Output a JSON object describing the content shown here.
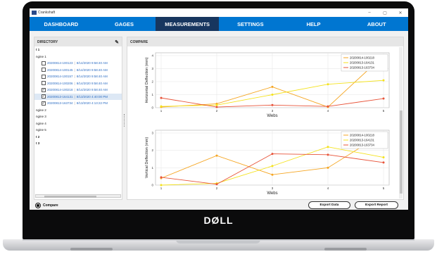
{
  "window": {
    "title": "Crankshaft",
    "min": "–",
    "max": "▢",
    "close": "✕"
  },
  "nav": {
    "tabs": [
      {
        "label": "DASHBOARD",
        "active": false
      },
      {
        "label": "GAGES",
        "active": false
      },
      {
        "label": "MEASUREMENTS",
        "active": true
      },
      {
        "label": "SETTINGS",
        "active": false
      },
      {
        "label": "HELP",
        "active": false
      },
      {
        "label": "ABOUT",
        "active": false
      }
    ],
    "accent": "#0076d1",
    "active_color": "#17365f"
  },
  "directory": {
    "title": "DIRECTORY",
    "edit_icon": "pencil-icon",
    "rows": [
      {
        "type": "group",
        "label": "t 1"
      },
      {
        "type": "group",
        "label": "ngine 1"
      },
      {
        "type": "file",
        "id": "20200814-100123",
        "date": "8/14/2020 9:58:40 AM",
        "checked": false,
        "selected": false
      },
      {
        "type": "file",
        "id": "20200814-100145",
        "date": "8/14/2020 9:58:40 AM",
        "checked": false,
        "selected": false
      },
      {
        "type": "file",
        "id": "20200814-100157",
        "date": "8/14/2020 9:58:40 AM",
        "checked": false,
        "selected": false
      },
      {
        "type": "file",
        "id": "20200814-100206",
        "date": "8/14/2020 9:58:40 AM",
        "checked": false,
        "selected": false
      },
      {
        "type": "file",
        "id": "20200814-100218",
        "date": "8/14/2020 9:58:40 AM",
        "checked": true,
        "selected": false
      },
      {
        "type": "file",
        "id": "20200813-164131",
        "date": "8/13/2020 4:40:00 PM",
        "checked": true,
        "selected": true
      },
      {
        "type": "file",
        "id": "20200813-163734",
        "date": "8/13/2020 4:13:22 PM",
        "checked": true,
        "selected": false
      },
      {
        "type": "group",
        "label": "ngine 2"
      },
      {
        "type": "group",
        "label": "ngine 3"
      },
      {
        "type": "group",
        "label": "ngine 4"
      },
      {
        "type": "group",
        "label": "ngine 5"
      },
      {
        "type": "group",
        "label": "t 2"
      },
      {
        "type": "group",
        "label": "t 3"
      }
    ]
  },
  "compare": {
    "title": "COMPARE"
  },
  "bottom": {
    "compare_label": "Compare",
    "export_data": "Export Data",
    "export_report": "Export Report"
  },
  "device": {
    "logo": "DØLL"
  },
  "chart_data": [
    {
      "type": "line",
      "xlabel": "Webs",
      "ylabel": "Horizontal Deflection (mm)",
      "x": [
        1,
        2,
        3,
        4,
        5
      ],
      "ylim": [
        0,
        4
      ],
      "yticks": [
        0,
        1,
        2,
        3,
        4
      ],
      "grid": true,
      "legend": "top-right",
      "series": [
        {
          "name": "20200814-100218",
          "color": "#f5a623",
          "values": [
            0.05,
            0.3,
            1.6,
            0.05,
            4.0
          ]
        },
        {
          "name": "20200813-164131",
          "color": "#f4e21c",
          "values": [
            0.1,
            0.2,
            1.0,
            1.8,
            2.1
          ]
        },
        {
          "name": "20200813-163734",
          "color": "#e8543a",
          "values": [
            0.75,
            0.05,
            0.2,
            0.1,
            0.7
          ]
        }
      ]
    },
    {
      "type": "line",
      "xlabel": "Webs",
      "ylabel": "Vertical Deflection (mm)",
      "x": [
        1,
        2,
        3,
        4,
        5
      ],
      "ylim": [
        0,
        3
      ],
      "yticks": [
        0,
        1,
        2,
        3
      ],
      "grid": true,
      "legend": "top-right",
      "series": [
        {
          "name": "20200814-100218",
          "color": "#f5a623",
          "values": [
            0.4,
            1.7,
            0.6,
            1.0,
            3.0
          ]
        },
        {
          "name": "20200813-164131",
          "color": "#f4e21c",
          "values": [
            0.0,
            0.1,
            1.1,
            2.2,
            1.6
          ]
        },
        {
          "name": "20200813-163734",
          "color": "#e8543a",
          "values": [
            0.45,
            0.05,
            1.8,
            1.75,
            1.3
          ]
        }
      ]
    }
  ]
}
